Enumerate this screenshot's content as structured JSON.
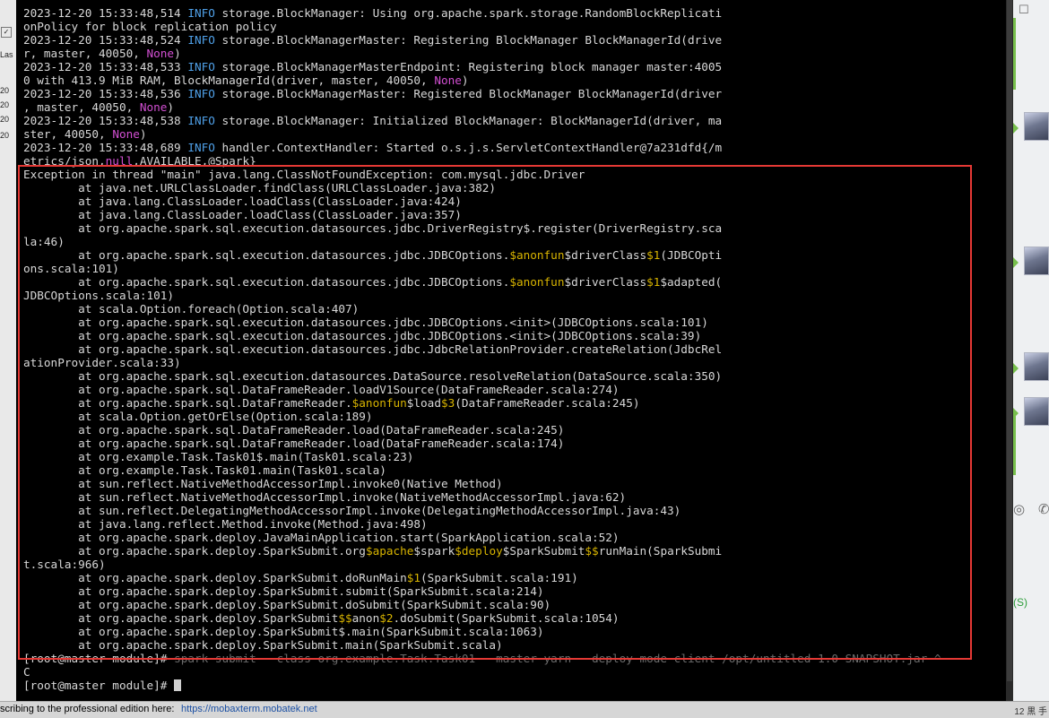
{
  "terminal": {
    "log_lines": [
      [
        {
          "t": "2023-12-20 15:33:48,514 "
        },
        {
          "t": "INFO",
          "c": "info"
        },
        {
          "t": " storage.BlockManager: Using org.apache.spark.storage.RandomBlockReplicati"
        }
      ],
      [
        {
          "t": "onPolicy for block replication policy"
        }
      ],
      [
        {
          "t": "2023-12-20 15:33:48,524 "
        },
        {
          "t": "INFO",
          "c": "info"
        },
        {
          "t": " storage.BlockManagerMaster: Registering BlockManager BlockManagerId(drive"
        }
      ],
      [
        {
          "t": "r, master, 40050, "
        },
        {
          "t": "None",
          "c": "none"
        },
        {
          "t": ")"
        }
      ],
      [
        {
          "t": "2023-12-20 15:33:48,533 "
        },
        {
          "t": "INFO",
          "c": "info"
        },
        {
          "t": " storage.BlockManagerMasterEndpoint: Registering block manager master:4005"
        }
      ],
      [
        {
          "t": "0 with 413.9 MiB RAM, BlockManagerId(driver, master, 40050, "
        },
        {
          "t": "None",
          "c": "none"
        },
        {
          "t": ")"
        }
      ],
      [
        {
          "t": "2023-12-20 15:33:48,536 "
        },
        {
          "t": "INFO",
          "c": "info"
        },
        {
          "t": " storage.BlockManagerMaster: Registered BlockManager BlockManagerId(driver"
        }
      ],
      [
        {
          "t": ", master, 40050, "
        },
        {
          "t": "None",
          "c": "none"
        },
        {
          "t": ")"
        }
      ],
      [
        {
          "t": "2023-12-20 15:33:48,538 "
        },
        {
          "t": "INFO",
          "c": "info"
        },
        {
          "t": " storage.BlockManager: Initialized BlockManager: BlockManagerId(driver, ma"
        }
      ],
      [
        {
          "t": "ster, 40050, "
        },
        {
          "t": "None",
          "c": "none"
        },
        {
          "t": ")"
        }
      ],
      [
        {
          "t": "2023-12-20 15:33:48,689 "
        },
        {
          "t": "INFO",
          "c": "info"
        },
        {
          "t": " handler.ContextHandler: Started o.s.j.s.ServletContextHandler@7a231dfd{/m"
        }
      ],
      [
        {
          "t": "etrics/json,"
        },
        {
          "t": "null",
          "c": "none"
        },
        {
          "t": ",AVAILABLE,@Spark}"
        }
      ]
    ],
    "exception_lines": [
      [
        {
          "t": "Exception in thread \"main\" java.lang.ClassNotFoundException: com.mysql.jdbc.Driver"
        }
      ],
      [
        {
          "t": "        at java.net.URLClassLoader.findClass(URLClassLoader.java:382)"
        }
      ],
      [
        {
          "t": "        at java.lang.ClassLoader.loadClass(ClassLoader.java:424)"
        }
      ],
      [
        {
          "t": "        at java.lang.ClassLoader.loadClass(ClassLoader.java:357)"
        }
      ],
      [
        {
          "t": "        at org.apache.spark.sql.execution.datasources.jdbc.DriverRegistry$.register(DriverRegistry.sca"
        }
      ],
      [
        {
          "t": "la:46)"
        }
      ],
      [
        {
          "t": "        at org.apache.spark.sql.execution.datasources.jdbc.JDBCOptions."
        },
        {
          "t": "$anonfun",
          "c": "dollar"
        },
        {
          "t": "$driverClass"
        },
        {
          "t": "$1",
          "c": "dollar"
        },
        {
          "t": "(JDBCOpti"
        }
      ],
      [
        {
          "t": "ons.scala:101)"
        }
      ],
      [
        {
          "t": "        at org.apache.spark.sql.execution.datasources.jdbc.JDBCOptions."
        },
        {
          "t": "$anonfun",
          "c": "dollar"
        },
        {
          "t": "$driverClass"
        },
        {
          "t": "$1",
          "c": "dollar"
        },
        {
          "t": "$adapted("
        }
      ],
      [
        {
          "t": "JDBCOptions.scala:101)"
        }
      ],
      [
        {
          "t": "        at scala.Option.foreach(Option.scala:407)"
        }
      ],
      [
        {
          "t": "        at org.apache.spark.sql.execution.datasources.jdbc.JDBCOptions.<init>(JDBCOptions.scala:101)"
        }
      ],
      [
        {
          "t": "        at org.apache.spark.sql.execution.datasources.jdbc.JDBCOptions.<init>(JDBCOptions.scala:39)"
        }
      ],
      [
        {
          "t": "        at org.apache.spark.sql.execution.datasources.jdbc.JdbcRelationProvider.createRelation(JdbcRel"
        }
      ],
      [
        {
          "t": "ationProvider.scala:33)"
        }
      ],
      [
        {
          "t": "        at org.apache.spark.sql.execution.datasources.DataSource.resolveRelation(DataSource.scala:350)"
        }
      ],
      [
        {
          "t": "        at org.apache.spark.sql.DataFrameReader.loadV1Source(DataFrameReader.scala:274)"
        }
      ],
      [
        {
          "t": "        at org.apache.spark.sql.DataFrameReader."
        },
        {
          "t": "$anonfun",
          "c": "dollar"
        },
        {
          "t": "$load"
        },
        {
          "t": "$3",
          "c": "dollar"
        },
        {
          "t": "(DataFrameReader.scala:245)"
        }
      ],
      [
        {
          "t": "        at scala.Option.getOrElse(Option.scala:189)"
        }
      ],
      [
        {
          "t": "        at org.apache.spark.sql.DataFrameReader.load(DataFrameReader.scala:245)"
        }
      ],
      [
        {
          "t": "        at org.apache.spark.sql.DataFrameReader.load(DataFrameReader.scala:174)"
        }
      ],
      [
        {
          "t": "        at org.example.Task.Task01$.main(Task01.scala:23)"
        }
      ],
      [
        {
          "t": "        at org.example.Task.Task01.main(Task01.scala)"
        }
      ],
      [
        {
          "t": "        at sun.reflect.NativeMethodAccessorImpl.invoke0(Native Method)"
        }
      ],
      [
        {
          "t": "        at sun.reflect.NativeMethodAccessorImpl.invoke(NativeMethodAccessorImpl.java:62)"
        }
      ],
      [
        {
          "t": "        at sun.reflect.DelegatingMethodAccessorImpl.invoke(DelegatingMethodAccessorImpl.java:43)"
        }
      ],
      [
        {
          "t": "        at java.lang.reflect.Method.invoke(Method.java:498)"
        }
      ],
      [
        {
          "t": "        at org.apache.spark.deploy.JavaMainApplication.start(SparkApplication.scala:52)"
        }
      ],
      [
        {
          "t": "        at org.apache.spark.deploy.SparkSubmit.org"
        },
        {
          "t": "$apache",
          "c": "dollar"
        },
        {
          "t": "$spark"
        },
        {
          "t": "$deploy",
          "c": "dollar"
        },
        {
          "t": "$SparkSubmit"
        },
        {
          "t": "$$",
          "c": "dollar"
        },
        {
          "t": "runMain(SparkSubmi"
        }
      ],
      [
        {
          "t": "t.scala:966)"
        }
      ],
      [
        {
          "t": "        at org.apache.spark.deploy.SparkSubmit.doRunMain"
        },
        {
          "t": "$1",
          "c": "dollar"
        },
        {
          "t": "(SparkSubmit.scala:191)"
        }
      ],
      [
        {
          "t": "        at org.apache.spark.deploy.SparkSubmit.submit(SparkSubmit.scala:214)"
        }
      ],
      [
        {
          "t": "        at org.apache.spark.deploy.SparkSubmit.doSubmit(SparkSubmit.scala:90)"
        }
      ],
      [
        {
          "t": "        at org.apache.spark.deploy.SparkSubmit"
        },
        {
          "t": "$$",
          "c": "dollar"
        },
        {
          "t": "anon"
        },
        {
          "t": "$2",
          "c": "dollar"
        },
        {
          "t": ".doSubmit(SparkSubmit.scala:1054)"
        }
      ],
      [
        {
          "t": "        at org.apache.spark.deploy.SparkSubmit$.main(SparkSubmit.scala:1063)"
        }
      ],
      [
        {
          "t": "        at org.apache.spark.deploy.SparkSubmit.main(SparkSubmit.scala)"
        }
      ]
    ],
    "command_line": [
      {
        "t": "[root@master module]# "
      },
      {
        "t": "spark-submit --class org.example.Task.Task01 --master yarn --deploy-mode client /opt/untitled-1.0-SNAPSHOT.jar ^",
        "c": "muted"
      }
    ],
    "ctrl_c_line": "C",
    "prompt": "[root@master module]# "
  },
  "status_bar": {
    "message": "scribing to the professional edition here:",
    "link": "https://mobaxterm.mobatek.net",
    "corner_text": "12 黒 手"
  },
  "left_strip": {
    "labels": [
      "Las",
      "20",
      "20",
      "20",
      "20"
    ]
  },
  "right_panel": {
    "shortcut_text": "(S)"
  }
}
